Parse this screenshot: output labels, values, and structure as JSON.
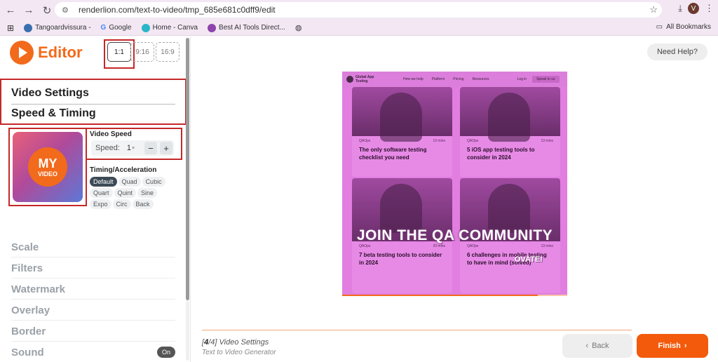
{
  "browser": {
    "url": "renderlion.com/text-to-video/tmp_685e681c0dff9/edit",
    "profile_initial": "V",
    "bookmarks": [
      {
        "label": "Tangoardvissura -",
        "color": "#3a6fb0"
      },
      {
        "label": "Google",
        "color": "#4285f4"
      },
      {
        "label": "Home - Canva",
        "color": "#2ab6c8"
      },
      {
        "label": "Best AI Tools Direct...",
        "color": "#8e44ad"
      }
    ],
    "all_bookmarks": "All Bookmarks"
  },
  "sidebar": {
    "logo_text": "Editor",
    "ratios": [
      "1:1",
      "9:16",
      "16:9"
    ],
    "video_settings": "Video Settings",
    "speed_timing": "Speed & Timing",
    "thumb_my": "MY",
    "thumb_video": "VIDEO",
    "video_speed_label": "Video Speed",
    "speed_prefix": "Speed:",
    "speed_value": "1",
    "speed_unit": "×",
    "minus": "−",
    "plus": "+",
    "timing_label": "Timing/Acceleration",
    "timing_options": [
      "Default",
      "Quad",
      "Cubic",
      "Quart",
      "Quint",
      "Sine",
      "Expo",
      "Circ",
      "Back"
    ],
    "menu": [
      "Scale",
      "Filters",
      "Watermark",
      "Overlay",
      "Border",
      "Sound"
    ],
    "sound_toggle": "On"
  },
  "main": {
    "help": "Need Help?",
    "step_current": "4",
    "step_total": "4",
    "step_name": "Video Settings",
    "step_sub": "Text to Video Generator",
    "back": "Back",
    "finish": "Finish"
  },
  "preview": {
    "brand": "Global App Testing",
    "nav": [
      "How we help",
      "Platform",
      "Pricing",
      "Resources"
    ],
    "login": "Log in",
    "cta": "Speak to us",
    "progress": 0.87,
    "cards": [
      {
        "tag": "QAOps",
        "time": "13 mins",
        "title": "The only software testing checklist you need"
      },
      {
        "tag": "QAOps",
        "time": "13 mins",
        "title": "5 iOS app testing tools to consider in 2024"
      },
      {
        "tag": "QAOps",
        "time": "20 mins",
        "title": "7 beta testing tools to consider in 2024"
      },
      {
        "tag": "QAOps",
        "time": "13 mins",
        "title": "6 challenges in mobile testing to have in mind (solved)"
      }
    ],
    "overlay_title": "JOIN THE QA COMMUNITY",
    "overlay_sub": "OVATE!"
  }
}
